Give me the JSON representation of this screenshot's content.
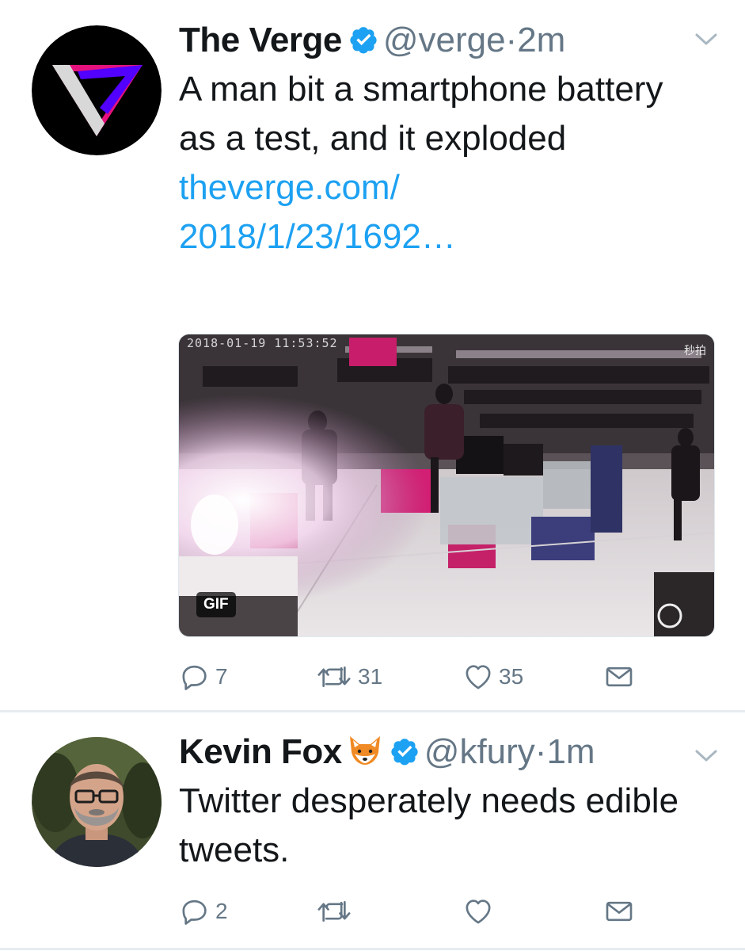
{
  "tweets": [
    {
      "name": "The Verge",
      "handle": "@verge",
      "separator": "·",
      "time": "2m",
      "text": "A man bit a smartphone battery as a test, and it exploded",
      "link_line1": "theverge.com/",
      "link_line2": "2018/1/23/1692…",
      "media": {
        "badge": "GIF",
        "timestamp_overlay": "2018-01-19 11:53:52",
        "watermark": "秒拍"
      },
      "actions": {
        "replies": "7",
        "retweets": "31",
        "likes": "35"
      }
    },
    {
      "name": "Kevin Fox",
      "handle": "@kfury",
      "separator": "·",
      "time": "1m",
      "text": "Twitter desperately needs edible tweets.",
      "actions": {
        "replies": "2",
        "retweets": "",
        "likes": ""
      }
    }
  ],
  "icons": {
    "verified": "verified-badge-icon",
    "caret": "chevron-down-icon",
    "reply": "reply-icon",
    "retweet": "retweet-icon",
    "like": "heart-icon",
    "dm": "envelope-icon",
    "fox": "fox-emoji-icon"
  },
  "colors": {
    "text": "#14171a",
    "secondary": "#657786",
    "link": "#1da1f2",
    "verified": "#1da1f2",
    "divider": "#e6ecf0",
    "verge_pink": "#e5127d",
    "verge_purple": "#5200ff"
  }
}
